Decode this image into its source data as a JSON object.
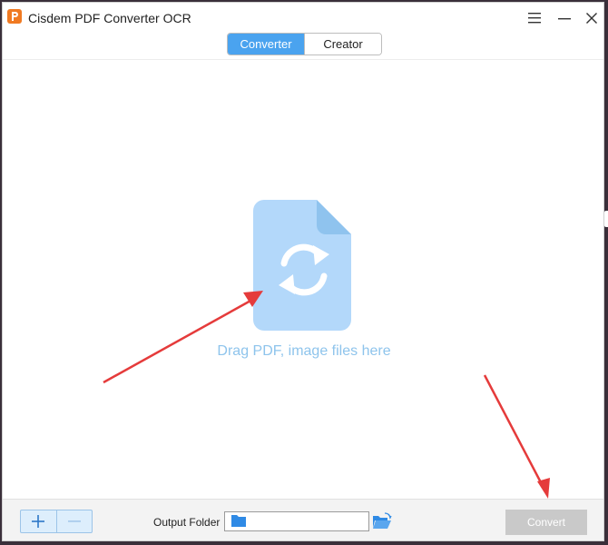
{
  "app": {
    "title": "Cisdem PDF Converter OCR"
  },
  "window_controls": {
    "menu": "menu-icon",
    "minimize": "minimize-icon",
    "close": "close-icon"
  },
  "tabs": [
    {
      "label": "Converter",
      "active": true
    },
    {
      "label": "Creator",
      "active": false
    }
  ],
  "drop_zone": {
    "text": "Drag PDF, image files here",
    "icon": "file-convert-icon"
  },
  "bottom_bar": {
    "add_icon": "plus-icon",
    "remove_icon": "minus-icon",
    "output_label": "Output Folder",
    "output_value": "",
    "convert_label": "Convert"
  },
  "colors": {
    "accent": "#4aa3ef",
    "drop_icon": "#b3d8fa",
    "drop_text": "#8ec4ec",
    "convert_disabled": "#c9c9c9",
    "annotation_arrow": "#e53b3b"
  }
}
